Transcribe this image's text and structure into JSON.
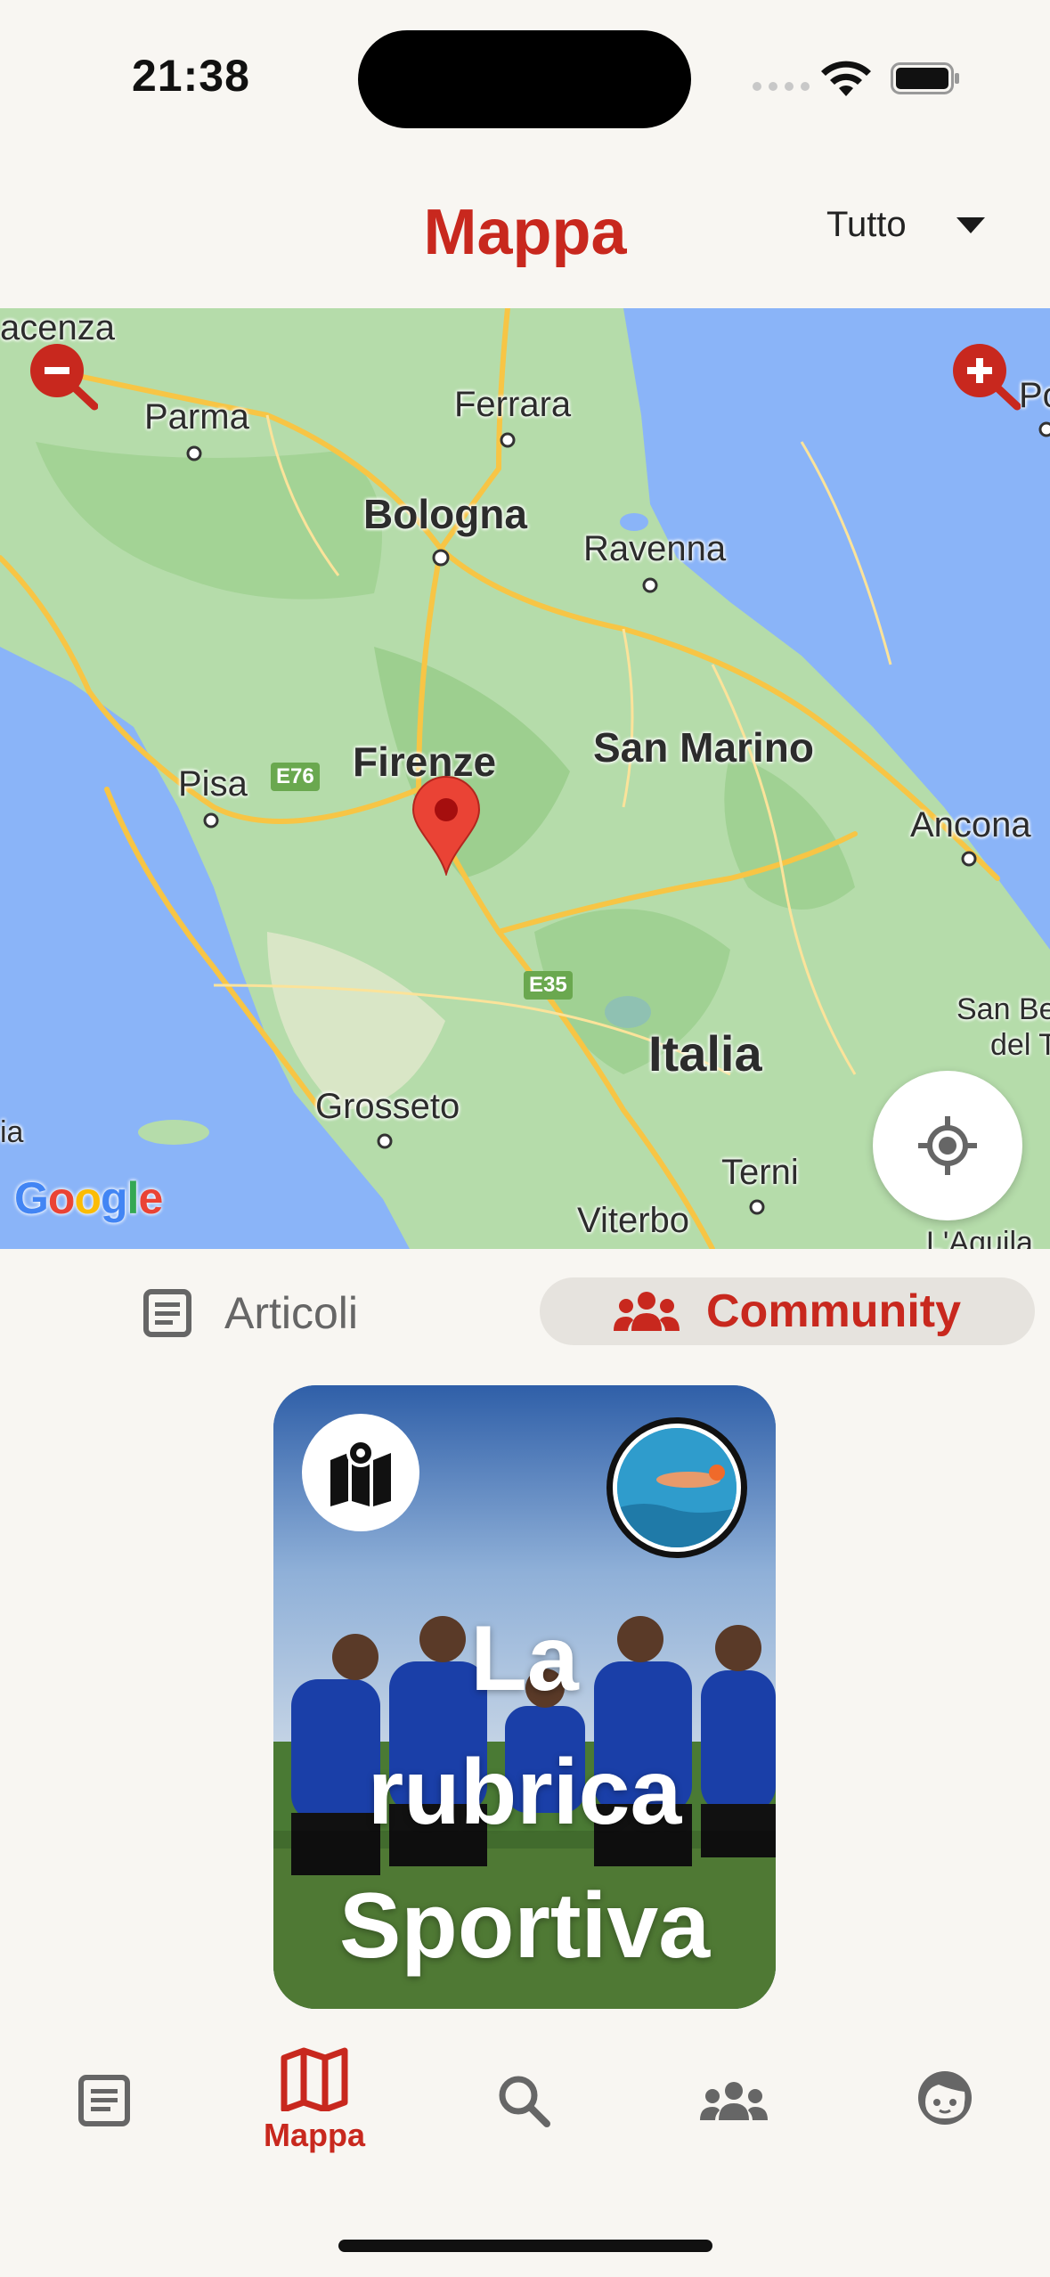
{
  "status_bar": {
    "time": "21:38"
  },
  "header": {
    "title": "Mappa",
    "filter_label": "Tutto"
  },
  "map": {
    "labels": {
      "piacenza": "acenza",
      "parma": "Parma",
      "ferrara": "Ferrara",
      "bologna": "Bologna",
      "ravenna": "Ravenna",
      "firenze": "Firenze",
      "san_marino": "San Marino",
      "pisa": "Pisa",
      "ancona": "Ancona",
      "italia": "Italia",
      "san_be": "San Be",
      "del_t": "del T",
      "grosseto": "Grosseto",
      "terni": "Terni",
      "viterbo": "Viterbo",
      "aquila": "L'Aquila",
      "ia": "ia",
      "po": "Po"
    },
    "road_shields": {
      "e76": "E76",
      "e35": "E35"
    },
    "attribution": "Google"
  },
  "segments": {
    "articoli": "Articoli",
    "community": "Community",
    "selected": "Community"
  },
  "card": {
    "title_line1": "La",
    "title_line2": "rubrica",
    "title_line3": "Sportiva"
  },
  "bottom_nav": {
    "active_label": "Mappa",
    "items": [
      "articles-icon",
      "map-icon",
      "search-icon",
      "community-icon",
      "profile-icon"
    ]
  },
  "colors": {
    "accent": "#c8281e",
    "background": "#f8f6f2"
  }
}
